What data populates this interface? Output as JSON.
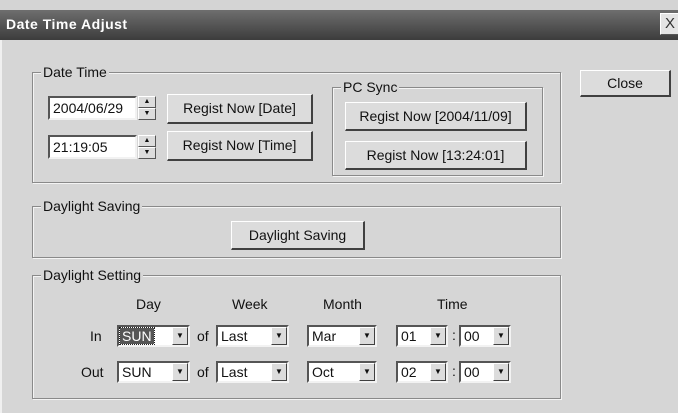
{
  "window": {
    "title": "Date Time Adjust",
    "close_glyph": "X"
  },
  "close_button": {
    "label": "Close"
  },
  "date_time": {
    "legend": "Date Time",
    "date_value": "2004/06/29",
    "time_value": "21:19:05",
    "regist_date_label": "Regist Now [Date]",
    "regist_time_label": "Regist Now [Time]"
  },
  "pc_sync": {
    "legend": "PC Sync",
    "regist_date_label": "Regist Now [2004/11/09]",
    "regist_time_label": "Regist Now [13:24:01]"
  },
  "daylight_saving": {
    "legend": "Daylight Saving",
    "button_label": "Daylight Saving"
  },
  "daylight_setting": {
    "legend": "Daylight Setting",
    "headers": {
      "day": "Day",
      "week": "Week",
      "month": "Month",
      "time": "Time"
    },
    "of_label": "of",
    "colon": ":",
    "in": {
      "label": "In",
      "day": "SUN",
      "week": "Last",
      "month": "Mar",
      "hour": "01",
      "minute": "00"
    },
    "out": {
      "label": "Out",
      "day": "SUN",
      "week": "Last",
      "month": "Oct",
      "hour": "02",
      "minute": "00"
    }
  }
}
